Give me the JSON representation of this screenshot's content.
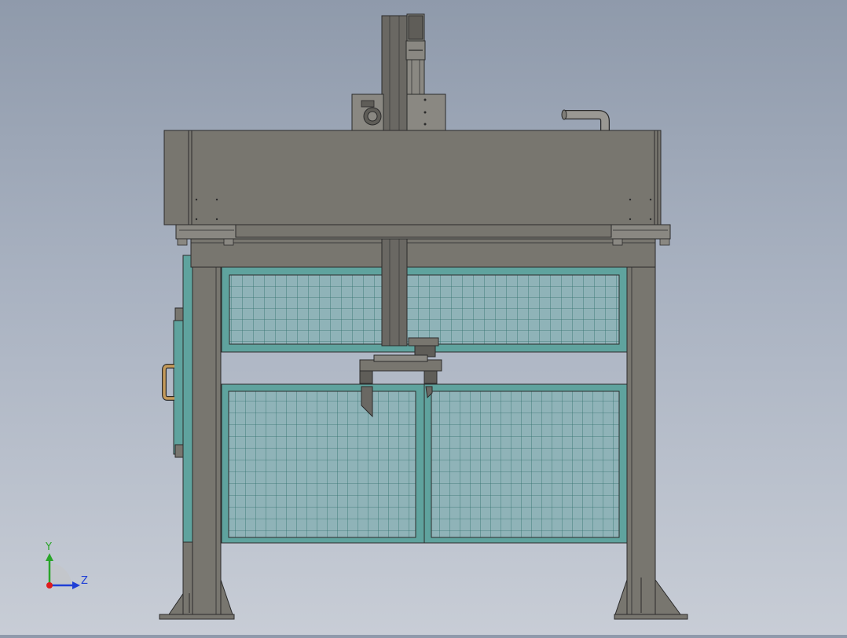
{
  "viewport": {
    "background_top": "#8f9aab",
    "background_bottom": "#c8cdd6"
  },
  "colors": {
    "steel": "#78766f",
    "steel_dark": "#5f5d58",
    "steel_light": "#8a8882",
    "outline": "#2b2b2b",
    "fence_frame": "#5fa39e",
    "fence_mesh": "#2f6e6b",
    "fence_fill": "#8fb3b8",
    "axis_x": "#e01b1b",
    "axis_y": "#2aa52a",
    "axis_z": "#1f3fd6"
  },
  "triad": {
    "y_label": "Y",
    "z_label": "Z",
    "icons": [
      "axis-triad-icon"
    ]
  },
  "model": {
    "components": [
      "overhead-beam-housing",
      "cross-beam",
      "left-column",
      "right-column",
      "upper-fence-panel",
      "lower-left-fence-panel",
      "lower-right-fence-panel",
      "vertical-z-axis-slide",
      "servo-motor-gearbox",
      "gripper-end-effector",
      "cable-hose",
      "side-access-door"
    ]
  }
}
